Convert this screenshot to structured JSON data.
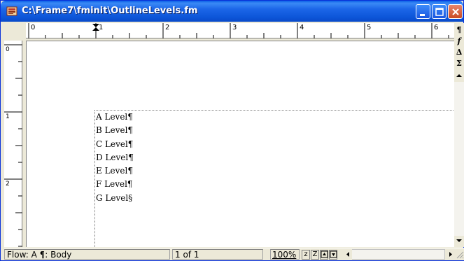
{
  "window": {
    "title": "C:\\Frame7\\fminit\\OutlineLevels.fm"
  },
  "ruler": {
    "h_numbers": [
      "0",
      "1",
      "2",
      "3",
      "4",
      "5",
      "6"
    ],
    "v_numbers": [
      "0",
      "1",
      "2"
    ]
  },
  "document": {
    "lines": [
      "A Level¶",
      "B Level¶",
      "C Level¶",
      "D Level¶",
      "E Level¶",
      "F Level¶",
      "G Level§"
    ]
  },
  "right_tools": {
    "pilcrow": "¶",
    "function": "f",
    "triangle": "∆",
    "sigma": "Σ"
  },
  "status": {
    "flow": "Flow: A  ¶: Body",
    "page": "1 of 1",
    "zoom": "100%",
    "z_small": "z",
    "z_large": "Z"
  },
  "colors": {
    "titlebar": "#0a5ee6",
    "chrome": "#ece9d8",
    "close": "#c94a22"
  }
}
